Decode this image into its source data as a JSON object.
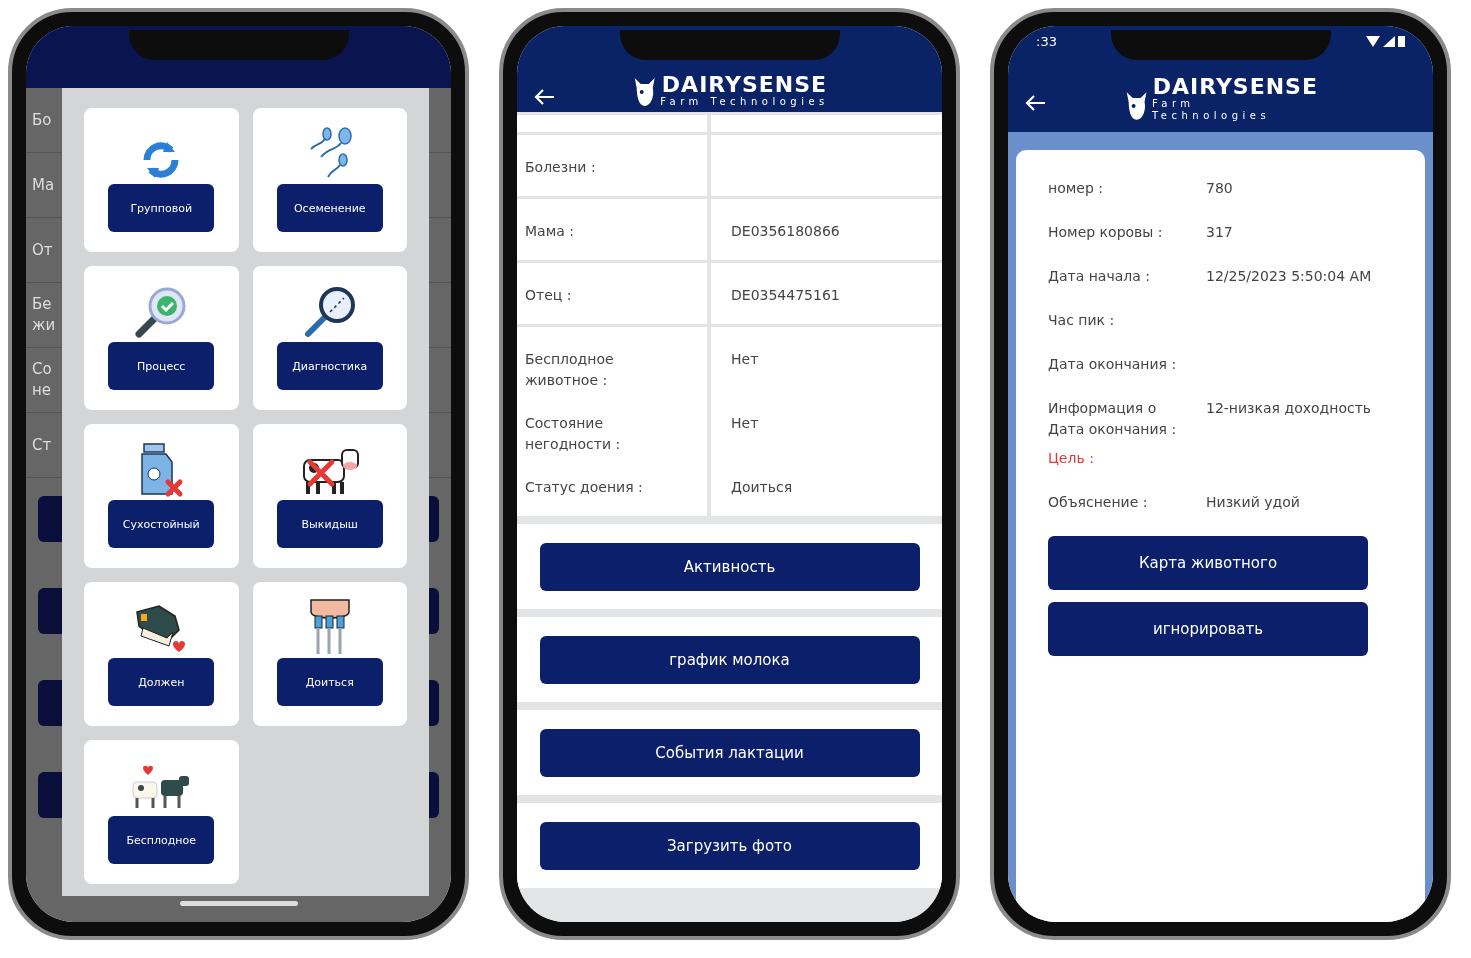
{
  "phones": [
    {
      "kind": "menu",
      "background_rows": [
        "Бо",
        "Ма",
        "От",
        "Бе жи",
        "Со не",
        "Ст"
      ],
      "menu_items": [
        {
          "label": "Групповой"
        },
        {
          "label": "Осеменение"
        },
        {
          "label": "Процесс"
        },
        {
          "label": "Диагностика"
        },
        {
          "label": "Сухостойный"
        },
        {
          "label": "Выкидыш"
        },
        {
          "label": "Должен"
        },
        {
          "label": "Доиться"
        },
        {
          "label": "Бесплодное"
        }
      ]
    },
    {
      "kind": "details",
      "logo": {
        "name": "DAIRYSENSE",
        "tagline": "Farm Technologies"
      },
      "rows": [
        {
          "label": "Болезни :"
        },
        {
          "label": "Мама :",
          "value": "DE0356180866"
        },
        {
          "label": "Отец :",
          "value": "DE0354475161"
        },
        {
          "label": "Бесплодное животное :",
          "value": "Нет"
        },
        {
          "label": "Состояние негодности :",
          "value": "Нет"
        },
        {
          "label": "Статус доения :",
          "value": "Доиться"
        }
      ],
      "buttons": [
        "Активность",
        "график молока",
        "События лактации",
        "Загрузить фото"
      ]
    },
    {
      "kind": "alert",
      "status_time": ":33",
      "logo": {
        "name": "DAIRYSENSE",
        "tagline": "Farm Technologies"
      },
      "rows": [
        {
          "label": "номер :",
          "value": "780",
          "highlight": false
        },
        {
          "label": "Номер коровы :",
          "value": "317",
          "highlight": false
        },
        {
          "label": "Дата начала :",
          "value": "12/25/2023 5:50:04 AM",
          "highlight": false
        },
        {
          "label": "Час пик :",
          "highlight": false
        },
        {
          "label": "Дата окончания :",
          "highlight": false
        },
        {
          "label": "Информация о Дата окончания :",
          "value": "12-низкая доходность",
          "highlight": false
        },
        {
          "label": "Цель :",
          "highlight": true
        },
        {
          "label": "Объяснение :",
          "value": "Низкий удой",
          "highlight": false
        }
      ],
      "buttons": [
        "Карта животного",
        "игнорировать"
      ]
    }
  ]
}
